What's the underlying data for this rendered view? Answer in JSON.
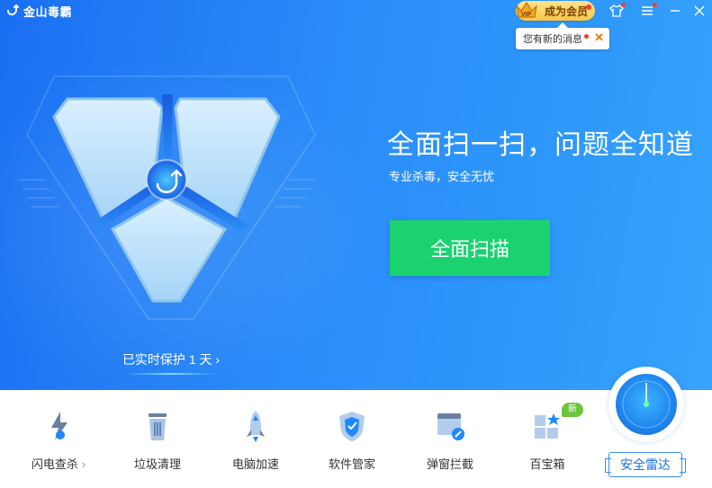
{
  "app": {
    "name": "金山毒霸"
  },
  "titlebar": {
    "vip_label": "成为会员",
    "vip_badge": "VIP",
    "icons": [
      "shirt-icon",
      "menu-icon",
      "minimize-icon",
      "close-icon"
    ]
  },
  "toast": {
    "text": "您有新的消息"
  },
  "hero": {
    "headline": "全面扫一扫，问题全知道",
    "subline": "专业杀毒，安全无忧",
    "scan_button": "全面扫描",
    "protect_text": "已实时保护 1 天 ›"
  },
  "tools": [
    {
      "label": "闪电查杀",
      "icon": "lightning-icon"
    },
    {
      "label": "垃圾清理",
      "icon": "trash-icon"
    },
    {
      "label": "电脑加速",
      "icon": "rocket-icon"
    },
    {
      "label": "软件管家",
      "icon": "shield-app-icon"
    },
    {
      "label": "弹窗拦截",
      "icon": "popup-block-icon"
    },
    {
      "label": "百宝箱",
      "icon": "toolbox-icon"
    }
  ],
  "tools_extra": {
    "arrow": "›",
    "new_badge": "新"
  },
  "radar": {
    "label": "安全雷达"
  },
  "colors": {
    "accent": "#1a6ff2",
    "scan_button": "#1ad36f",
    "vip": "#f7c64a",
    "new_badge": "#6cc53a"
  }
}
